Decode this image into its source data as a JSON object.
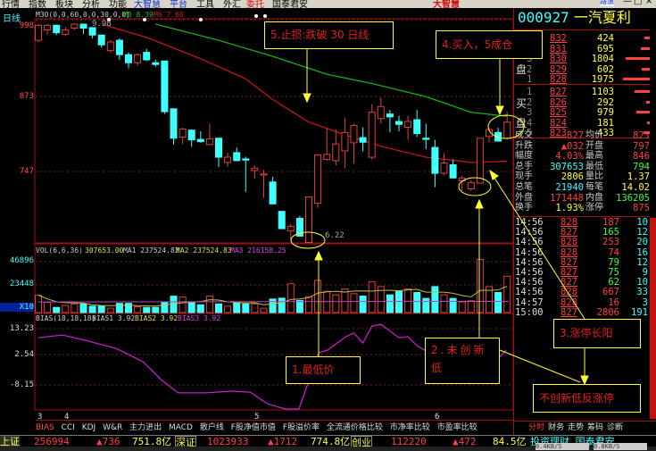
{
  "menu": [
    "行情",
    "指数",
    "板块",
    "分析",
    "功能",
    "大智慧",
    "平台",
    "工具",
    "外汇",
    "委托",
    "国泰君安"
  ],
  "app_logo": "大智慧",
  "window_buttons": [
    "路演",
    "—",
    "□",
    "×"
  ],
  "chart": {
    "period": "日线",
    "ma_header": "M30(0,0,60,0,0,30,0,0)",
    "ma3_label": "M3 8.39",
    "ma6_label": "M6 7.68",
    "price_ticks": [
      "998",
      "873",
      "747"
    ],
    "high_label": "9.98",
    "low_label": "6.22",
    "date_ticks": [
      "3",
      "4",
      "5",
      "6"
    ],
    "colors": {
      "up": "#e04040",
      "down": "#40ffff",
      "ma30": "#c01818",
      "ma60": "#18b018",
      "bias": "#c020c0"
    }
  },
  "chart_data": {
    "type": "candlestick",
    "ylim": [
      600,
      998
    ],
    "candles": [
      [
        970,
        998,
        967,
        996
      ],
      [
        988,
        998,
        979,
        996
      ],
      [
        996,
        997,
        979,
        983
      ],
      [
        980,
        993,
        978,
        988
      ],
      [
        991,
        998,
        988,
        998
      ],
      [
        998,
        998,
        981,
        991
      ],
      [
        992,
        993,
        973,
        979
      ],
      [
        979,
        979,
        957,
        962
      ],
      [
        952,
        970,
        949,
        967
      ],
      [
        970,
        973,
        936,
        945
      ],
      [
        945,
        949,
        921,
        931
      ],
      [
        931,
        947,
        926,
        945
      ],
      [
        949,
        955,
        934,
        936
      ],
      [
        931,
        936,
        924,
        928
      ],
      [
        934,
        934,
        842,
        846
      ],
      [
        851,
        852,
        789,
        800
      ],
      [
        802,
        818,
        790,
        816
      ],
      [
        814,
        815,
        785,
        797
      ],
      [
        798,
        812,
        792,
        794
      ],
      [
        789,
        825,
        789,
        799
      ],
      [
        800,
        800,
        750,
        767
      ],
      [
        758,
        775,
        750,
        767
      ],
      [
        775,
        784,
        761,
        761
      ],
      [
        764,
        768,
        707,
        762
      ],
      [
        744,
        753,
        730,
        748
      ],
      [
        736,
        745,
        697,
        738
      ],
      [
        724,
        733,
        686,
        686
      ],
      [
        673,
        673,
        643,
        643
      ],
      [
        639,
        651,
        621,
        647
      ],
      [
        661,
        665,
        629,
        630
      ],
      [
        619,
        699,
        622,
        698
      ],
      [
        687,
        771,
        679,
        771
      ],
      [
        763,
        818,
        761,
        772
      ],
      [
        761,
        815,
        753,
        790
      ],
      [
        778,
        836,
        748,
        810
      ],
      [
        792,
        825,
        756,
        822
      ],
      [
        801,
        819,
        777,
        793
      ],
      [
        767,
        859,
        763,
        845
      ],
      [
        834,
        870,
        825,
        855
      ],
      [
        842,
        849,
        810,
        837
      ],
      [
        829,
        839,
        812,
        824
      ],
      [
        819,
        839,
        797,
        829
      ],
      [
        832,
        849,
        802,
        808
      ],
      [
        800,
        825,
        781,
        798
      ],
      [
        784,
        797,
        715,
        739
      ],
      [
        739,
        774,
        735,
        757
      ],
      [
        754,
        763,
        730,
        731
      ],
      [
        726,
        735,
        709,
        731
      ],
      [
        712,
        727,
        709,
        723
      ],
      [
        722,
        800,
        722,
        800
      ],
      [
        803,
        818,
        793,
        815
      ],
      [
        810,
        818,
        794,
        795
      ],
      [
        800,
        846,
        797,
        828
      ]
    ],
    "ma30": [
      [
        8,
        998
      ],
      [
        13,
        975
      ],
      [
        19,
        938
      ],
      [
        24,
        903
      ],
      [
        27,
        867
      ],
      [
        31,
        828
      ],
      [
        35,
        806
      ],
      [
        39,
        786
      ],
      [
        44,
        767
      ],
      [
        49,
        758
      ],
      [
        53,
        760
      ]
    ],
    "ma60": [
      [
        14,
        998
      ],
      [
        21,
        970
      ],
      [
        27,
        942
      ],
      [
        33,
        911
      ],
      [
        38,
        895
      ],
      [
        44,
        872
      ],
      [
        49,
        845
      ],
      [
        53,
        838
      ]
    ],
    "volume": {
      "header": "VOL(6,6,36)",
      "value": "307653.00",
      "ma1": "MA1 237524.83",
      "ma2": "MA2 237524.83",
      "ma3": "MA3 216158.25",
      "ticks": [
        "46896",
        "23448",
        "X10"
      ],
      "ylim": [
        0,
        50000
      ],
      "values": [
        14650,
        8540,
        4390,
        6100,
        7300,
        7300,
        5370,
        5370,
        3660,
        7810,
        7810,
        4880,
        4390,
        4390,
        9030,
        13900,
        13180,
        8540,
        6590,
        13900,
        7320,
        5370,
        8540,
        7320,
        7320,
        3660,
        11470,
        12200,
        24400,
        10250,
        13420,
        27330,
        18000,
        15000,
        20000,
        16000,
        14000,
        26000,
        22000,
        15000,
        18000,
        20000,
        17000,
        12000,
        22000,
        15000,
        12000,
        9000,
        10000,
        45000,
        22000,
        17000,
        30765
      ]
    },
    "bias": {
      "header": "BIAS(18,18,18)",
      "bias1": "BIAS1 3.92",
      "bias2": "BIAS2 3.92",
      "bias3": "BIAS3 3.92",
      "ticks": [
        "13.23",
        "2.54",
        "-8.15"
      ],
      "ylim": [
        -22,
        15
      ],
      "points": [
        [
          1,
          9.5
        ],
        [
          3.7,
          10.6
        ],
        [
          6.6,
          8
        ],
        [
          9.6,
          5.1
        ],
        [
          12.6,
          -0.4
        ],
        [
          14.6,
          -7.8
        ],
        [
          16.5,
          -13.3
        ],
        [
          19.5,
          -13.3
        ],
        [
          22.5,
          -12.6
        ],
        [
          24.5,
          -13
        ],
        [
          26.4,
          -17.8
        ],
        [
          28.4,
          -20
        ],
        [
          29.9,
          -20
        ],
        [
          32.1,
          3.3
        ],
        [
          33.1,
          4.4
        ],
        [
          35.1,
          9.9
        ],
        [
          36,
          11.4
        ],
        [
          37,
          7.3
        ],
        [
          38,
          14.3
        ],
        [
          39,
          15
        ],
        [
          41,
          9.5
        ],
        [
          42,
          9.9
        ],
        [
          43,
          6.2
        ],
        [
          44,
          4
        ],
        [
          45.3,
          -4.9
        ],
        [
          47,
          -7.8
        ],
        [
          49,
          -9.6
        ],
        [
          50.2,
          2.2
        ],
        [
          51.9,
          0.3
        ],
        [
          52.9,
          4.4
        ]
      ]
    }
  },
  "annotations": {
    "n1": "1.最低价",
    "n2": "2.未创新低",
    "n3": "3.涨停长阳",
    "n4": "4.买入，5成仓",
    "n5": "5.止损:跌破 30 日线",
    "n6": "不创新低反涨停"
  },
  "indicator_tabs": [
    "BIAS",
    "CCI",
    "KDJ",
    "W&R",
    "主力进出",
    "MACD",
    "散户线",
    "F股净值市值",
    "F股溢价率",
    "全流通价格比较",
    "市净率比较",
    "市盈率比较"
  ],
  "quote": {
    "code": "000927",
    "name": "一汽夏利",
    "sell_label": [
      "卖",
      "盘"
    ],
    "buy_label": [
      "买",
      "盘"
    ],
    "sell": [
      {
        "lvl": "5",
        "price": "832",
        "vol": "424",
        "frac": 0.21
      },
      {
        "lvl": "4",
        "price": "831",
        "vol": "695",
        "frac": 0.35
      },
      {
        "lvl": "3",
        "price": "830",
        "vol": "1804",
        "frac": 0.9
      },
      {
        "lvl": "2",
        "price": "829",
        "vol": "602",
        "frac": 0.3
      },
      {
        "lvl": "1",
        "price": "828",
        "vol": "1975",
        "frac": 1.0
      }
    ],
    "buy": [
      {
        "lvl": "1",
        "price": "827",
        "vol": "1103",
        "frac": 0.56
      },
      {
        "lvl": "2",
        "price": "826",
        "vol": "292",
        "frac": 0.15
      },
      {
        "lvl": "3",
        "price": "825",
        "vol": "979",
        "frac": 0.5
      },
      {
        "lvl": "4",
        "price": "824",
        "vol": "181",
        "frac": 0.09
      },
      {
        "lvl": "5",
        "price": "823",
        "vol": "433",
        "frac": 0.22
      }
    ],
    "stats": [
      {
        "l1": "成交",
        "v1": "827",
        "c1": "#ff4040",
        "l2": "均价",
        "v2": "823",
        "c2": "#ff4040"
      },
      {
        "l1": "升跌",
        "v1": "▲032",
        "c1": "#ff4040",
        "l2": "开盘",
        "v2": "797",
        "c2": "#ff4040"
      },
      {
        "l1": "幅度",
        "v1": "4.03%",
        "c1": "#ff4040",
        "l2": "最高",
        "v2": "846",
        "c2": "#ff4040"
      },
      {
        "l1": "总手",
        "v1": "307653",
        "c1": "#40ffff",
        "l2": "最低",
        "v2": "794",
        "c2": "#40ff40"
      },
      {
        "l1": "现手",
        "v1": "2806",
        "c1": "#ffff40",
        "l2": "量比",
        "v2": "1.37",
        "c2": "#ffff40"
      },
      {
        "l1": "总笔",
        "v1": "21940",
        "c1": "#40ffff",
        "l2": "每笔",
        "v2": "14.02",
        "c2": "#ffff40"
      },
      {
        "l1": "外盘",
        "v1": "171448",
        "c1": "#ff4040",
        "l2": "内盘",
        "v2": "136205",
        "c2": "#40ff40"
      },
      {
        "l1": "换手",
        "v1": "1.93%",
        "c1": "#ffff40",
        "l2": "涨停",
        "v2": "875",
        "c2": "#ff4040"
      }
    ],
    "ticks": [
      {
        "t": "14:56",
        "p": "828",
        "v": "187",
        "n": "10",
        "vc": "#ff4040"
      },
      {
        "t": "14:56",
        "p": "827",
        "v": "165",
        "n": "12",
        "vc": "#40ff40"
      },
      {
        "t": "14:56",
        "p": "828",
        "v": "253",
        "n": "20",
        "vc": "#ff4040"
      },
      {
        "t": "14:56",
        "p": "828",
        "v": "74",
        "n": "16",
        "vc": "#ff4040"
      },
      {
        "t": "14:56",
        "p": "827",
        "v": "79",
        "n": "12",
        "vc": "#40ff40"
      },
      {
        "t": "14:56",
        "p": "827",
        "v": "75",
        "n": "9",
        "vc": "#40ff40"
      },
      {
        "t": "14:56",
        "p": "827",
        "v": "62",
        "n": "10",
        "vc": "#40ff40"
      },
      {
        "t": "14:56",
        "p": "828",
        "v": "667",
        "n": "33",
        "vc": "#ff4040"
      },
      {
        "t": "14:57",
        "p": "828",
        "v": "16",
        "n": "3",
        "vc": "#ff4040"
      },
      {
        "t": "15:00",
        "p": "827",
        "v": "2806",
        "n": "191",
        "vc": "#ff4040"
      }
    ],
    "tabs": [
      "分时",
      "财务",
      "走势",
      "筹码",
      "诊断"
    ]
  },
  "status": {
    "sh_label": "上证",
    "sh_vol": "256994",
    "sh_chg": "▲736",
    "sh_amt": "751.8亿",
    "sz_label": "深证",
    "sz_vol": "1023933",
    "sz_chg": "▲1712",
    "sz_amt": "774.8亿",
    "cy_label": "创业",
    "cy_vol": "112220",
    "cy_chg": "▲472",
    "cy_amt": "84.5亿",
    "ticker": "投资理财 国泰君安",
    "net_down": "0.4KB/S",
    "net_up": "0.8KB/S"
  }
}
